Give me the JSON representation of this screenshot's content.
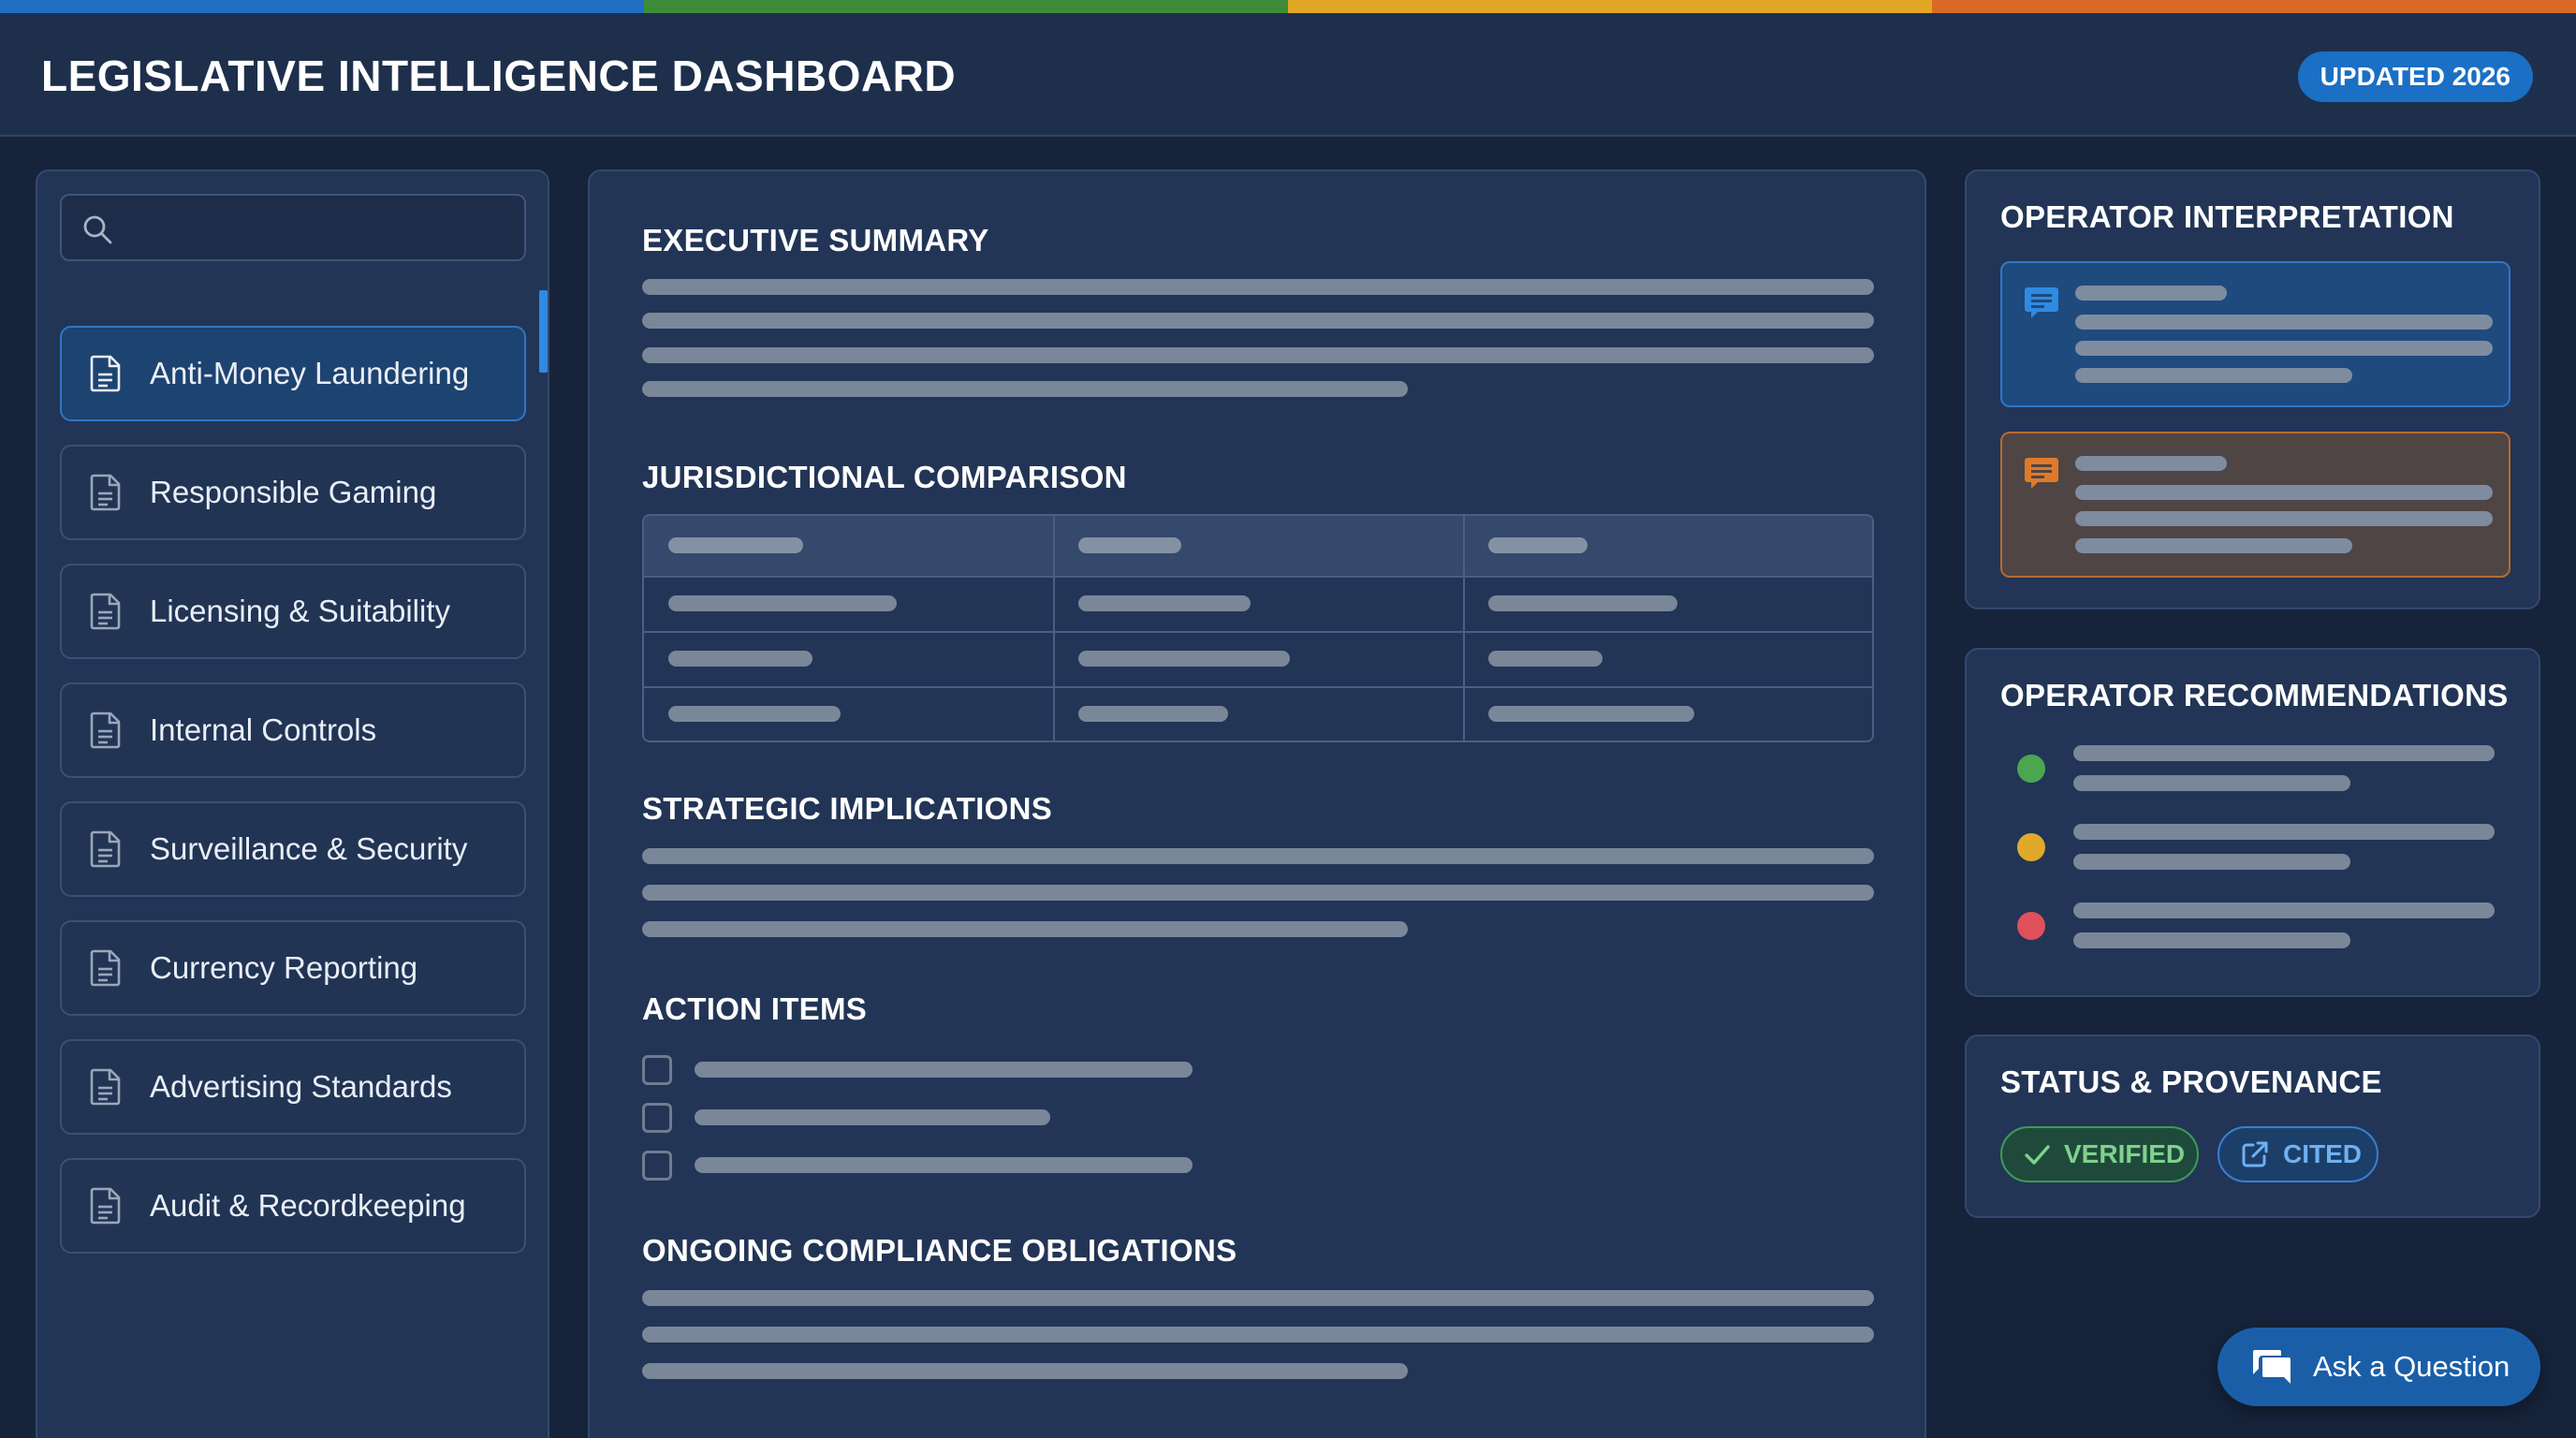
{
  "accent_colors": [
    "#1f6fc4",
    "#3e8c3a",
    "#e1a724",
    "#d96a26"
  ],
  "header": {
    "title": "LEGISLATIVE INTELLIGENCE DASHBOARD",
    "badge": "UPDATED 2026"
  },
  "sidebar": {
    "search": {
      "placeholder": "",
      "value": ""
    },
    "active_index": 0,
    "items": [
      {
        "label": "Anti-Money Laundering",
        "icon": "document-icon"
      },
      {
        "label": "Responsible Gaming",
        "icon": "document-icon"
      },
      {
        "label": "Licensing & Suitability",
        "icon": "document-icon"
      },
      {
        "label": "Internal Controls",
        "icon": "document-icon"
      },
      {
        "label": "Surveillance & Security",
        "icon": "document-icon"
      },
      {
        "label": "Currency Reporting",
        "icon": "document-icon"
      },
      {
        "label": "Advertising Standards",
        "icon": "document-icon"
      },
      {
        "label": "Audit & Recordkeeping",
        "icon": "document-icon"
      }
    ]
  },
  "main": {
    "sections": {
      "executive_summary": "EXECUTIVE SUMMARY",
      "jurisdictional_comparison": "JURISDICTIONAL COMPARISON",
      "strategic_implications": "STRATEGIC IMPLICATIONS",
      "action_items": "ACTION ITEMS",
      "ongoing_obligations": "ONGOING COMPLIANCE OBLIGATIONS"
    },
    "action_items": [
      {
        "checked": false
      },
      {
        "checked": false
      },
      {
        "checked": false
      }
    ]
  },
  "right": {
    "interpretation": {
      "heading": "OPERATOR INTERPRETATION",
      "cards": [
        {
          "icon": "comment-icon",
          "color": "#2f8be0"
        },
        {
          "icon": "comment-icon",
          "color": "#e07a2a"
        }
      ]
    },
    "recommendations": {
      "heading": "OPERATOR RECOMMENDATIONS",
      "status_colors": [
        "#4ca54f",
        "#e0a92a",
        "#e0505a"
      ]
    },
    "status": {
      "heading": "STATUS & PROVENANCE",
      "verified_label": "VERIFIED",
      "cited_label": "CITED"
    }
  },
  "ask_button": {
    "label": "Ask a Question",
    "icon": "chat-icon"
  }
}
